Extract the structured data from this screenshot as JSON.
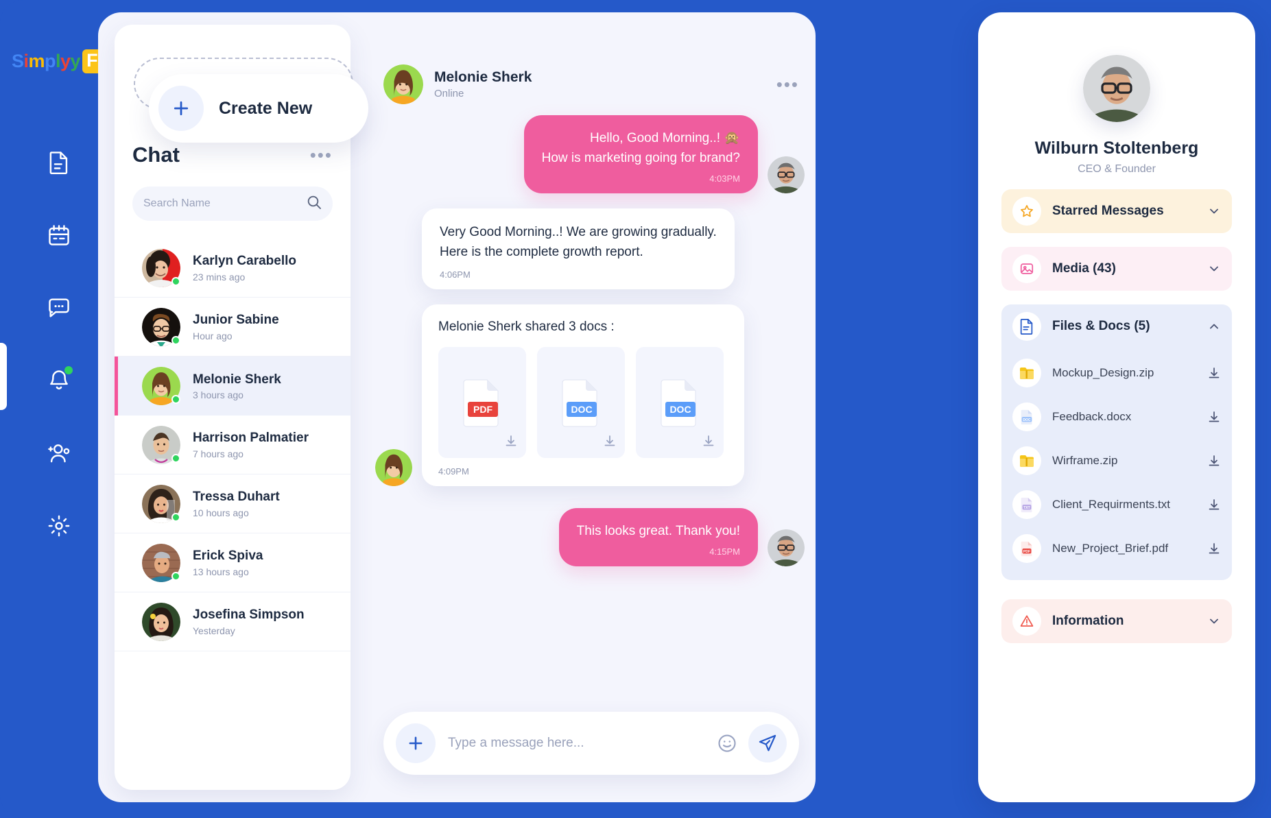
{
  "brand": {
    "logo_parts": [
      {
        "ch": "S",
        "color": "#4285f4"
      },
      {
        "ch": "i",
        "color": "#ea4335"
      },
      {
        "ch": "m",
        "color": "#fbbc05"
      },
      {
        "ch": "p",
        "color": "#4285f4"
      },
      {
        "ch": "l",
        "color": "#34a853"
      },
      {
        "ch": "y",
        "color": "#ea4335"
      },
      {
        "ch": "y",
        "color": "#34a853"
      }
    ],
    "logo_badge": "Fi",
    "logo_badge_bg": "#fcc419",
    "primary": "#2559c9",
    "accent_pink": "#ef5d9e"
  },
  "rail": {
    "items": [
      {
        "name": "document-icon",
        "label": "Documents",
        "badge": false
      },
      {
        "name": "calendar-icon",
        "label": "Calendar",
        "badge": false
      },
      {
        "name": "chat-icon",
        "label": "Chat",
        "badge": false
      },
      {
        "name": "bell-icon",
        "label": "Notifications",
        "badge": true
      },
      {
        "name": "add-people-icon",
        "label": "Contacts",
        "badge": false
      },
      {
        "name": "gear-icon",
        "label": "Settings",
        "badge": false
      }
    ]
  },
  "sidebar": {
    "create_new_label": "Create New",
    "create_new_icon": "plus-icon",
    "title": "Chat",
    "more_icon": "ellipsis-icon",
    "search_placeholder": "Search Name",
    "search_value": "",
    "search_icon": "search-icon",
    "chats": [
      {
        "name": "Karlyn Carabello",
        "time": "23 mins ago",
        "online": true,
        "active": false
      },
      {
        "name": "Junior Sabine",
        "time": "Hour ago",
        "online": true,
        "active": false
      },
      {
        "name": "Melonie Sherk",
        "time": "3 hours ago",
        "online": true,
        "active": true
      },
      {
        "name": "Harrison Palmatier",
        "time": "7 hours ago",
        "online": true,
        "active": false
      },
      {
        "name": "Tressa Duhart",
        "time": "10 hours ago",
        "online": true,
        "active": false
      },
      {
        "name": "Erick Spiva",
        "time": "13 hours ago",
        "online": true,
        "active": false
      },
      {
        "name": "Josefina Simpson",
        "time": "Yesterday",
        "online": false,
        "active": false
      }
    ]
  },
  "conversation": {
    "header": {
      "name": "Melonie Sherk",
      "status": "Online",
      "more_icon": "ellipsis-icon"
    },
    "messages": [
      {
        "id": "m1",
        "side": "out",
        "lines": [
          "Hello, Good Morning..! 🙊",
          "How is marketing going for brand?"
        ],
        "time": "4:03PM"
      },
      {
        "id": "m2",
        "side": "in",
        "lines": [
          "Very Good Morning..! We are growing gradually.",
          "Here is the complete growth report."
        ],
        "time": "4:06PM"
      },
      {
        "id": "m3",
        "side": "in",
        "type": "docs",
        "docs_title": "Melonie Sherk shared 3 docs :",
        "docs": [
          {
            "type": "PDF",
            "download_icon": "download-icon"
          },
          {
            "type": "DOC",
            "download_icon": "download-icon"
          },
          {
            "type": "DOC",
            "download_icon": "download-icon"
          }
        ],
        "time": "4:09PM"
      },
      {
        "id": "m4",
        "side": "out",
        "lines": [
          "This looks great. Thank you!"
        ],
        "time": "4:15PM"
      }
    ],
    "composer": {
      "plus_icon": "plus-icon",
      "placeholder": "Type a message here...",
      "value": "",
      "emoji_icon": "smiley-icon",
      "send_icon": "send-icon"
    }
  },
  "profile": {
    "avatar": "profile-avatar",
    "name": "Wilburn Stoltenberg",
    "role": "CEO & Founder",
    "sections": [
      {
        "key": "starred",
        "label": "Starred Messages",
        "icon": "star-icon",
        "expanded": false,
        "chevron": "chevron-down-icon"
      },
      {
        "key": "media",
        "label": "Media (43)",
        "icon": "image-icon",
        "expanded": false,
        "chevron": "chevron-down-icon"
      },
      {
        "key": "files",
        "label": "Files & Docs (5)",
        "icon": "file-icon",
        "expanded": true,
        "chevron": "chevron-up-icon"
      },
      {
        "key": "information",
        "label": "Information",
        "icon": "warning-icon",
        "expanded": false,
        "chevron": "chevron-down-icon"
      }
    ],
    "files": [
      {
        "name": "Mockup_Design.zip",
        "icon": "zip-icon",
        "download_icon": "download-icon"
      },
      {
        "name": "Feedback.docx",
        "icon": "doc-icon",
        "download_icon": "download-icon"
      },
      {
        "name": "Wirframe.zip",
        "icon": "zip-icon",
        "download_icon": "download-icon"
      },
      {
        "name": "Client_Requirments.txt",
        "icon": "txt-icon",
        "download_icon": "download-icon"
      },
      {
        "name": "New_Project_Brief.pdf",
        "icon": "pdf-icon",
        "download_icon": "download-icon"
      }
    ]
  }
}
